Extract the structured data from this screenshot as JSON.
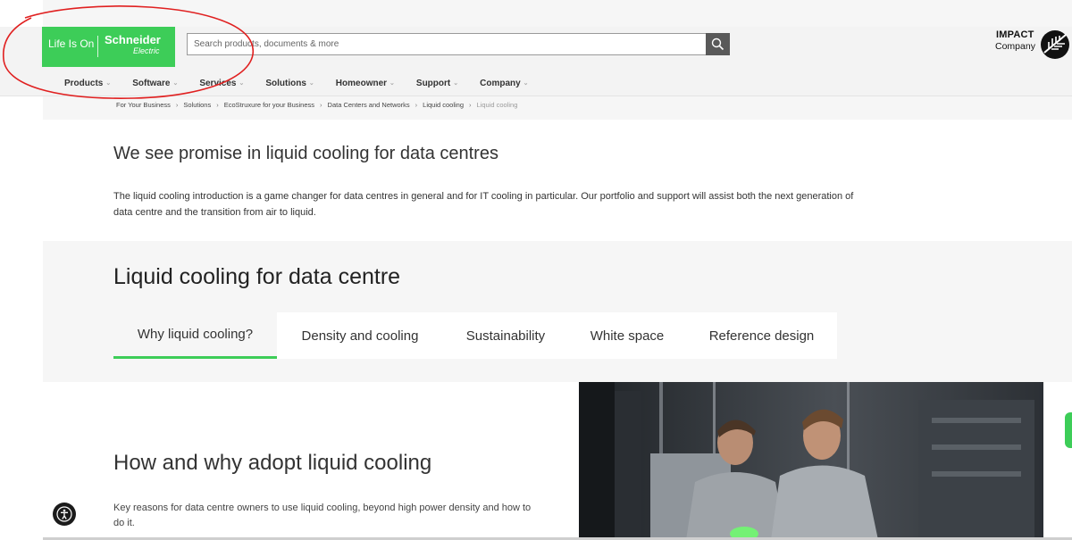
{
  "header": {
    "logo": {
      "tagline": "Life Is On",
      "brand": "Schneider",
      "brand_sub": "Electric"
    },
    "search": {
      "placeholder": "Search products, documents & more"
    },
    "impact": {
      "line1": "IMPACT",
      "line2": "Company"
    },
    "nav": [
      {
        "label": "Products"
      },
      {
        "label": "Software"
      },
      {
        "label": "Services"
      },
      {
        "label": "Solutions"
      },
      {
        "label": "Homeowner"
      },
      {
        "label": "Support"
      },
      {
        "label": "Company"
      }
    ]
  },
  "breadcrumb": [
    {
      "label": "For Your Business"
    },
    {
      "label": "Solutions"
    },
    {
      "label": "EcoStruxure for your Business"
    },
    {
      "label": "Data Centers and Networks"
    },
    {
      "label": "Liquid cooling"
    },
    {
      "label": "Liquid cooling"
    }
  ],
  "intro": {
    "title": "We see promise in liquid cooling for data centres",
    "body": "The liquid cooling introduction is a game changer for data centres in general and for IT cooling in particular. Our portfolio and support will assist both the next generation of data centre and the transition from air to liquid."
  },
  "section": {
    "title": "Liquid cooling for data centre",
    "tabs": [
      {
        "label": "Why liquid cooling?"
      },
      {
        "label": "Density and cooling"
      },
      {
        "label": "Sustainability"
      },
      {
        "label": "White space"
      },
      {
        "label": "Reference design"
      }
    ],
    "active_tab": "Why liquid cooling?"
  },
  "content": {
    "title": "How and why adopt liquid cooling",
    "body": "Key reasons for data centre owners to use liquid cooling, beyond high power density and how to do it."
  },
  "colors": {
    "brand_green": "#3dcd58",
    "annotation_red": "#e02020",
    "search_button": "#595959"
  }
}
